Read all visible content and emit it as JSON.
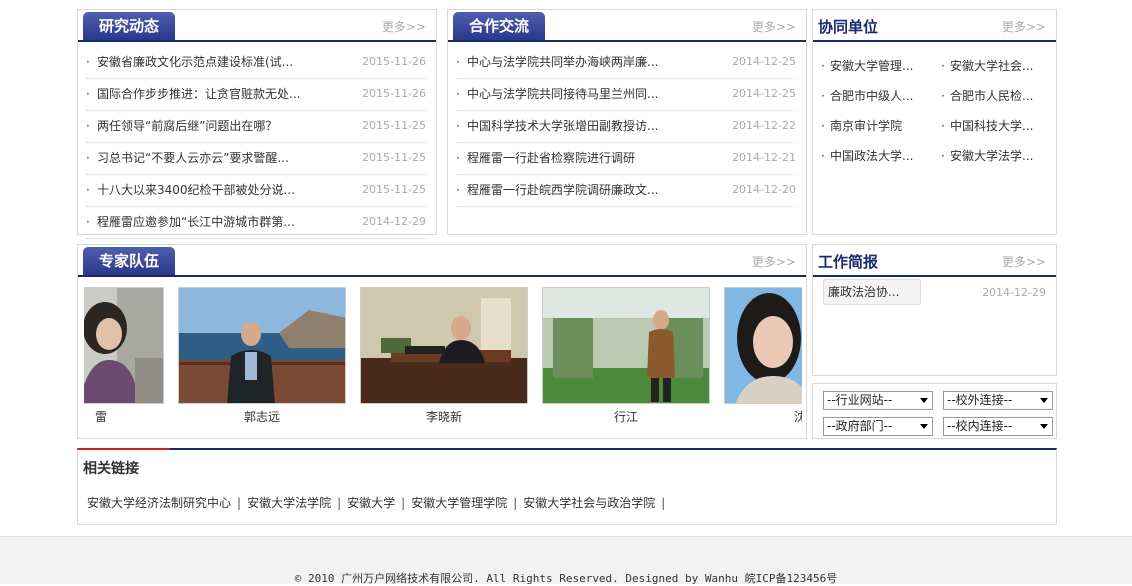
{
  "research": {
    "title": "研究动态",
    "more": "更多>>",
    "items": [
      {
        "title": "安徽省廉政文化示范点建设标准(试...",
        "date": "2015-11-26"
      },
      {
        "title": "国际合作步步推进：让贪官赃款无处...",
        "date": "2015-11-26"
      },
      {
        "title": "两任领导“前腐后继”问题出在哪？",
        "date": "2015-11-25"
      },
      {
        "title": "习总书记“不要人云亦云”要求警醒...",
        "date": "2015-11-25"
      },
      {
        "title": "十八大以来3400纪检干部被处分说...",
        "date": "2015-11-25"
      },
      {
        "title": "程雁雷应邀参加“长江中游城市群第...",
        "date": "2014-12-29"
      }
    ]
  },
  "cooperation": {
    "title": "合作交流",
    "more": "更多>>",
    "items": [
      {
        "title": "中心与法学院共同举办海峡两岸廉...",
        "date": "2014-12-25"
      },
      {
        "title": "中心与法学院共同接待马里兰州同...",
        "date": "2014-12-25"
      },
      {
        "title": "中国科学技术大学张增田副教授访...",
        "date": "2014-12-22"
      },
      {
        "title": "程雁雷一行赴省检察院进行调研",
        "date": "2014-12-21"
      },
      {
        "title": "程雁雷一行赴皖西学院调研廉政文...",
        "date": "2014-12-20"
      }
    ]
  },
  "partners": {
    "title": "协同单位",
    "more": "更多>>",
    "items": [
      "安徽大学管理...",
      "安徽大学社会...",
      "合肥市中级人...",
      "合肥市人民检...",
      "南京审计学院",
      "中国科技大学...",
      "中国政法大学...",
      "安徽大学法学..."
    ]
  },
  "experts": {
    "title": "专家队伍",
    "more": "更多>>",
    "people": [
      "雷",
      "郭志远",
      "李晓新",
      "行江",
      "沈"
    ]
  },
  "brief": {
    "title": "工作简报",
    "more": "更多>>",
    "items": [
      {
        "title": "廉政法治协...",
        "date": "2014-12-29"
      }
    ]
  },
  "selects": [
    "--行业网站--",
    "--校外连接--",
    "--政府部门--",
    "--校内连接--"
  ],
  "related": {
    "title": "相关链接",
    "links": [
      "安徽大学经济法制研究中心",
      "安徽大学法学院",
      "安徽大学",
      "安徽大学管理学院",
      "安徽大学社会与政治学院"
    ],
    "sep": "|"
  },
  "footer": {
    "text": "© 2010 广州万户网络技术有限公司. All Rights Reserved. Designed by Wanhu 皖ICP备123456号"
  },
  "colors": {
    "accent": "#2a3889",
    "border": "#d8d8d8",
    "date": "#aaaaaa",
    "related_line": "#cc2222"
  }
}
